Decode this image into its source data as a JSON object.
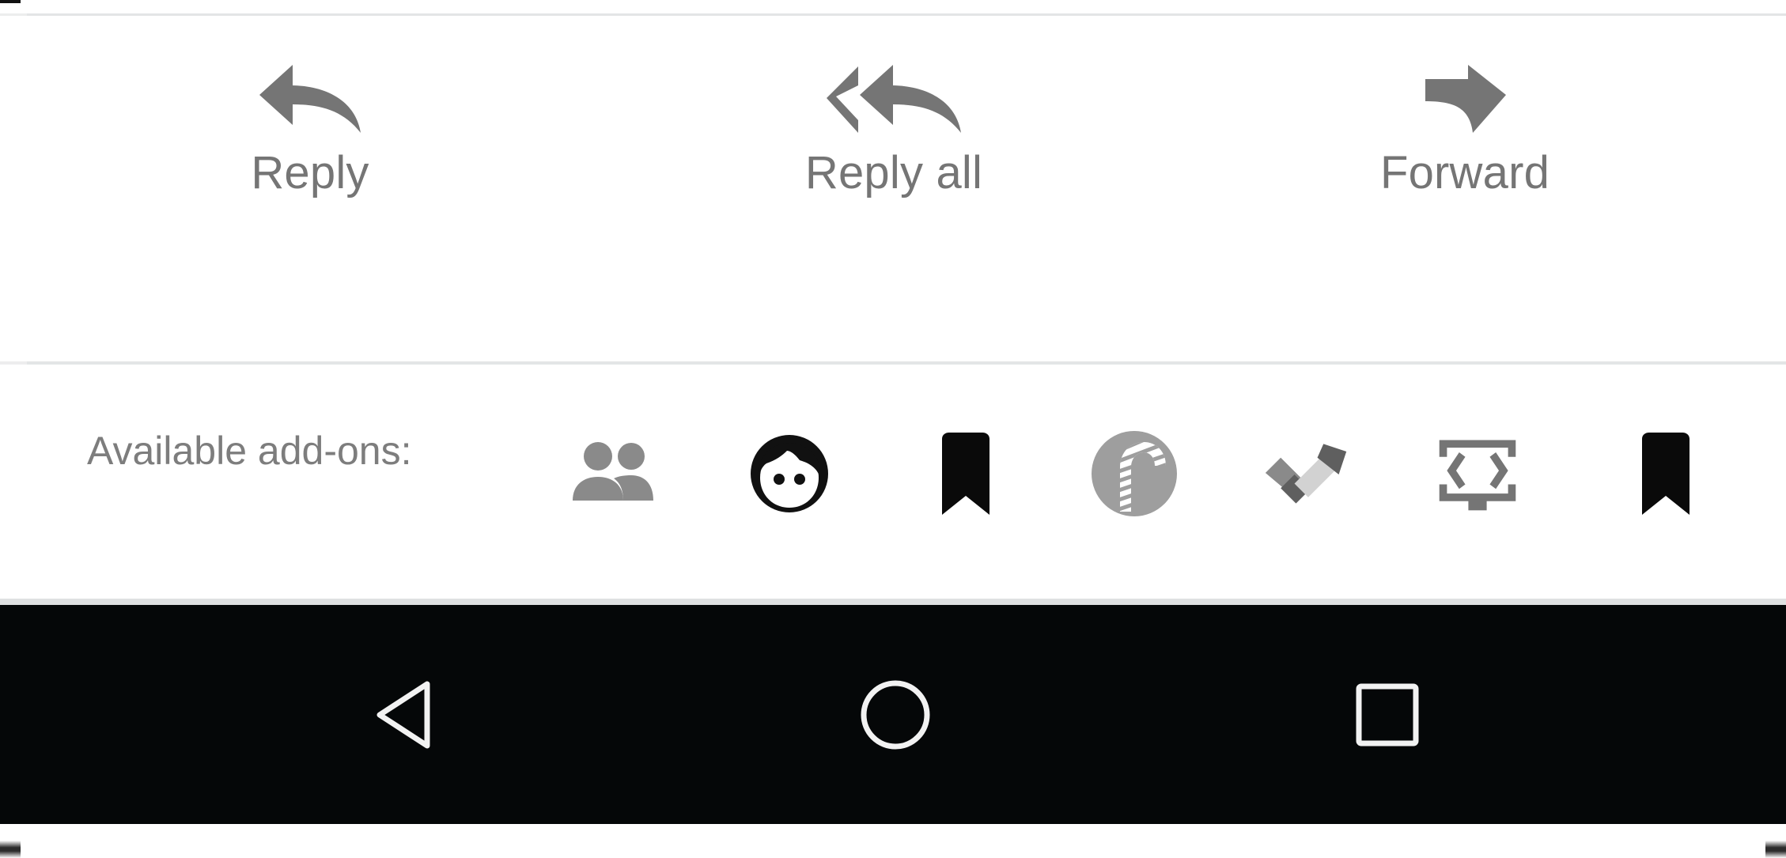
{
  "window": {
    "platform": "android",
    "background": "#ffffff"
  },
  "colors": {
    "icon_gray": "#757575",
    "label_gray": "#757575",
    "addons_label_gray": "#7d7d7d",
    "divider_gray": "#e3e5e6",
    "navbar_black": "#050708",
    "navbar_icon": "#f2f2f2",
    "icon_black": "#0a0a0a",
    "candy_circle_gray": "#9e9e9e"
  },
  "action_bar": {
    "items": [
      {
        "label": "Reply",
        "icon": "reply-icon"
      },
      {
        "label": "Reply all",
        "icon": "reply-all-icon"
      },
      {
        "label": "Forward",
        "icon": "forward-icon"
      }
    ]
  },
  "addons_bar": {
    "label": "Available add-ons:",
    "icons": [
      {
        "name": "people-group-icon",
        "color": "#8a8a8a"
      },
      {
        "name": "person-face-icon",
        "color": "#111111"
      },
      {
        "name": "bookmark-icon",
        "color": "#0a0a0a"
      },
      {
        "name": "candy-cane-icon",
        "color": "#9e9e9e"
      },
      {
        "name": "checkmark-icon",
        "color": "#8a8a8a"
      },
      {
        "name": "code-screen-icon",
        "color": "#757575"
      },
      {
        "name": "bookmark-icon-2",
        "color": "#0a0a0a"
      }
    ],
    "edge_markers": [
      "left-scroll-dash",
      "right-scroll-dash"
    ]
  },
  "nav_bar": {
    "buttons": [
      {
        "name": "back-button",
        "icon": "triangle-left-icon"
      },
      {
        "name": "home-button",
        "icon": "circle-icon"
      },
      {
        "name": "recents-button",
        "icon": "square-icon"
      }
    ]
  }
}
